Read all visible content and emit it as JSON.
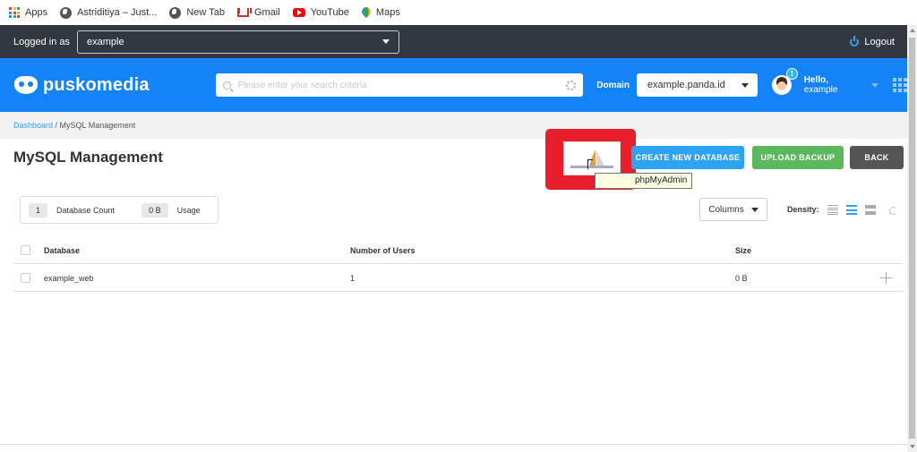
{
  "bookmarks": [
    {
      "label": "Apps",
      "icon": "apps-icon"
    },
    {
      "label": "Astriditiya – Just...",
      "icon": "globe-icon"
    },
    {
      "label": "New Tab",
      "icon": "globe-icon"
    },
    {
      "label": "Gmail",
      "icon": "gmail-icon"
    },
    {
      "label": "YouTube",
      "icon": "youtube-icon"
    },
    {
      "label": "Maps",
      "icon": "maps-icon"
    }
  ],
  "topbar": {
    "logged_in_label": "Logged in as",
    "account_value": "example",
    "logout_label": "Logout"
  },
  "header": {
    "brand": "puskomedia",
    "search_placeholder": "Please enter your search criteria",
    "domain_label": "Domain",
    "domain_value": "example.panda.id",
    "notification_count": "1",
    "hello_prefix": "Hello,",
    "hello_user": "example"
  },
  "breadcrumb": {
    "root": "Dashboard",
    "separator": " / ",
    "current": "MySQL Management"
  },
  "page": {
    "title": "MySQL Management",
    "phpmyadmin_tooltip": "phpMyAdmin",
    "create_label": "CREATE NEW DATABASE",
    "upload_label": "UPLOAD BACKUP",
    "back_label": "BACK"
  },
  "stats": {
    "db_count_value": "1",
    "db_count_label": "Database Count",
    "usage_value": "0 B",
    "usage_label": "Usage"
  },
  "toolbar": {
    "columns_label": "Columns",
    "density_label": "Density:"
  },
  "table": {
    "headers": [
      "Database",
      "Number of Users",
      "Size"
    ],
    "rows": [
      {
        "database": "example_web",
        "users": "1",
        "size": "0 B"
      }
    ]
  },
  "colors": {
    "header_blue": "#1483f8",
    "dark_bar": "#333740",
    "create_button": "#2ea3f2",
    "upload_button": "#5cb85c",
    "back_button": "#555555",
    "highlight_red": "#e81f2a"
  }
}
